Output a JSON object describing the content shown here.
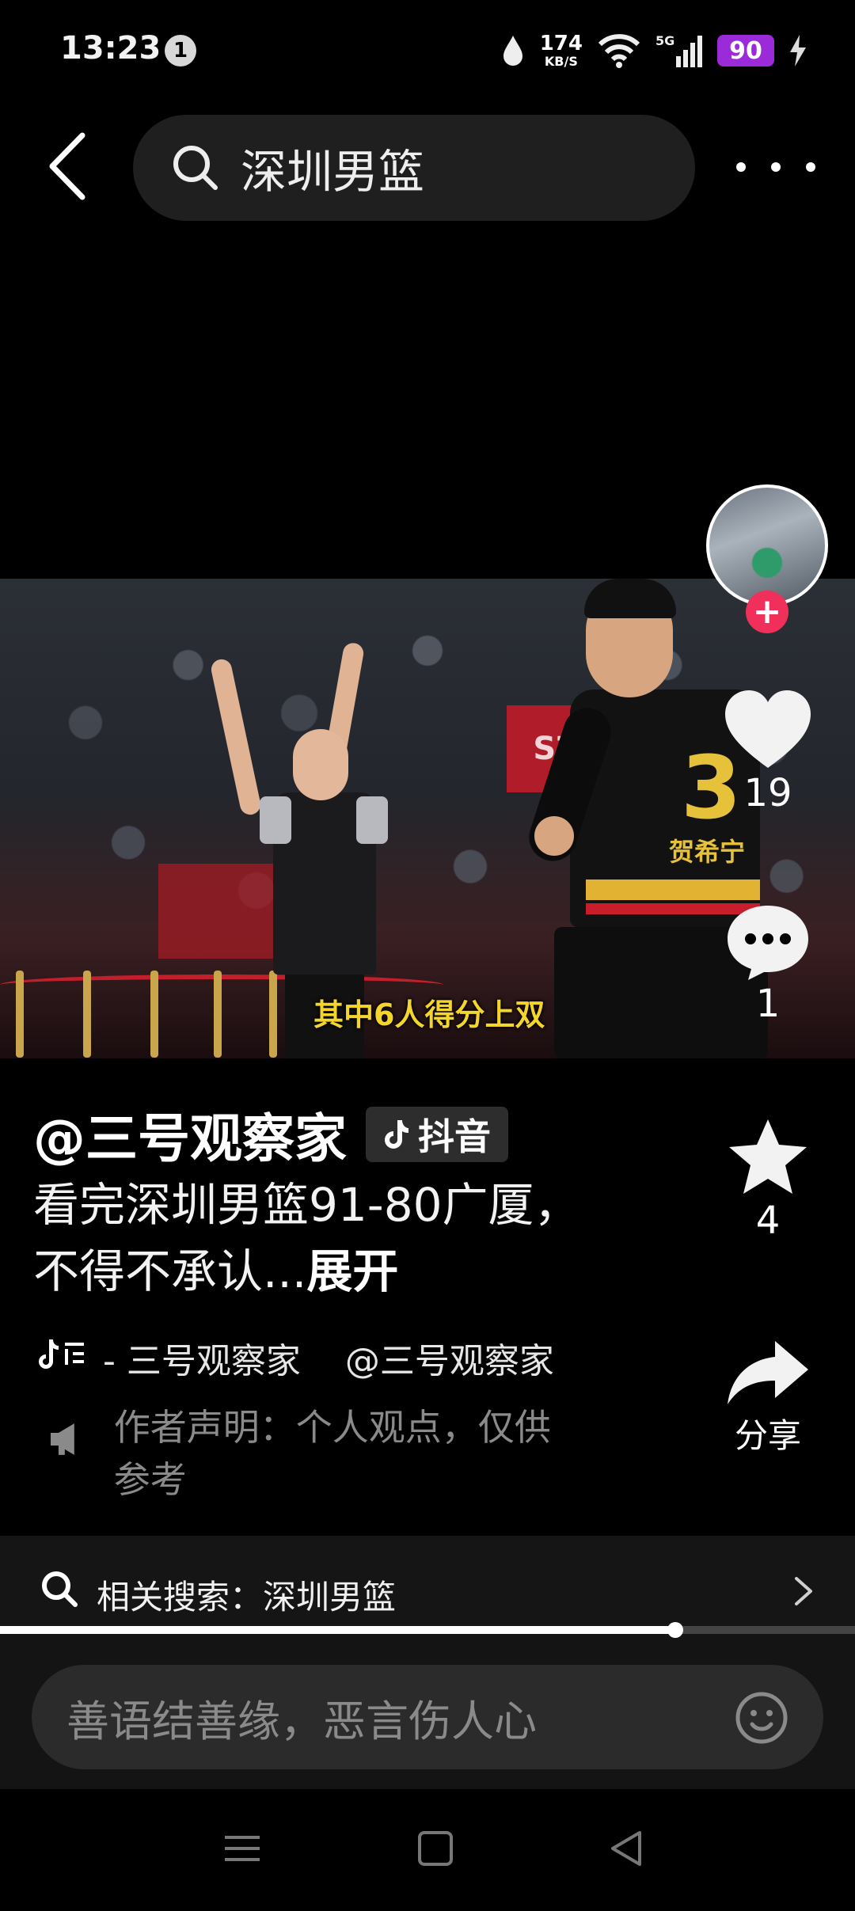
{
  "status_bar": {
    "time": "13:23",
    "notification_count": "1",
    "net_speed": "174",
    "net_unit": "KB/S",
    "network": "5G",
    "battery": "90"
  },
  "header": {
    "search_query": "深圳男篮"
  },
  "video": {
    "subtitle": "其中6人得分上双",
    "banner_text": "SZL",
    "jersey_number": "3",
    "jersey_name": "贺希宁"
  },
  "actions": {
    "likes": "19",
    "comments": "1",
    "favorites": "4",
    "share_label": "分享"
  },
  "post": {
    "author": "@三号观察家",
    "badge": "抖音",
    "description": "看完深圳男篮91-80广厦，不得不承认...",
    "expand_label": "展开",
    "music": "- 三号观察家",
    "mention": "@三号观察家",
    "statement": "作者声明：个人观点，仅供参考"
  },
  "related_search": {
    "label": "相关搜索：深圳男篮"
  },
  "playback": {
    "progress": 0.79
  },
  "comment_box": {
    "placeholder": "善语结善缘，恶言伤人心"
  },
  "colors": {
    "battery": "#9b2bd8",
    "follow": "#f0305a",
    "subtitle": "#f4d52c"
  }
}
